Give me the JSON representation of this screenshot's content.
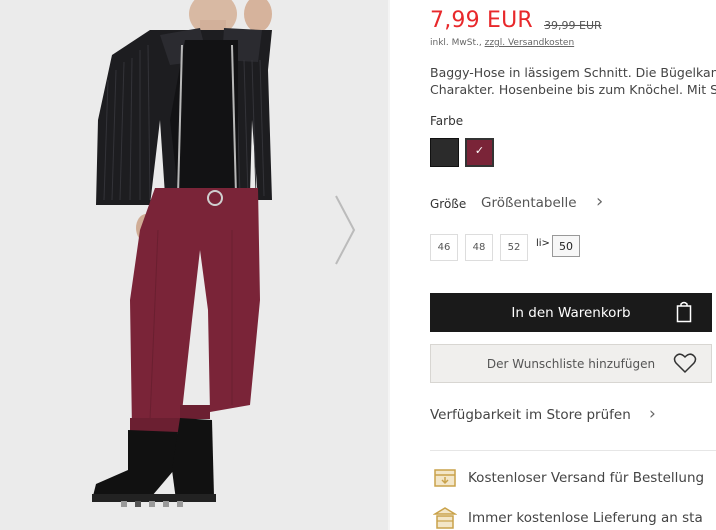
{
  "product": {
    "price": "7,99 EUR",
    "old_price": "39,99 EUR",
    "tax_prefix": "inkl. MwSt., ",
    "tax_link": "zzgl. Versandkosten",
    "description_line1": "Baggy-Hose in lässigem Schnitt. Die Bügelkant",
    "description_line2": "Charakter. Hosenbeine bis zum Knöchel. Mit Sp"
  },
  "color": {
    "label": "Farbe",
    "swatches": [
      {
        "name": "black",
        "hex": "#2b2b2b"
      },
      {
        "name": "bordeaux",
        "hex": "#7a2438",
        "selected": true,
        "check": "✓"
      }
    ]
  },
  "size": {
    "label": "Größe",
    "chart_link": "Größentabelle",
    "chevron": "›",
    "options": [
      "46",
      "48",
      "52"
    ],
    "icon_text": "li>",
    "selected": "50"
  },
  "actions": {
    "add_to_cart": "In den Warenkorb",
    "wishlist": "Der Wunschliste hinzufügen",
    "store_availability": "Verfügbarkeit im Store prüfen",
    "store_chevron": "›"
  },
  "info": {
    "shipping": "Kostenloser Versand für Bestellung",
    "store_delivery": "Immer kostenlose Lieferung an sta"
  },
  "gallery": {
    "next_icon": "chevron-right-icon",
    "dot_count": 5,
    "active_dot": 1
  },
  "colors": {
    "accent_price": "#e8282b",
    "button_dark": "#1a1a1a",
    "wishlist_bg": "#f0efed",
    "icon_gold": "#c9a24a"
  }
}
